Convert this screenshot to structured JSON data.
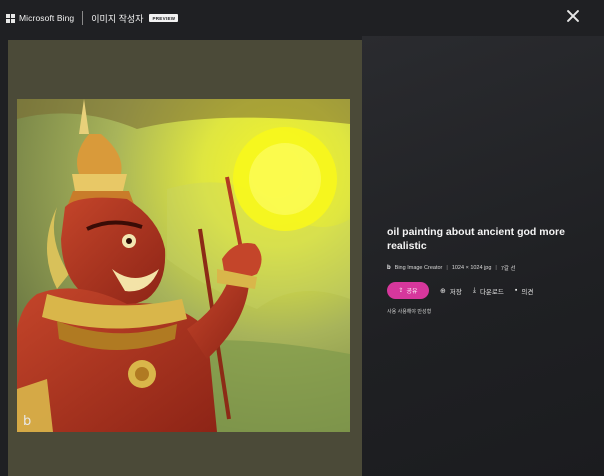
{
  "header": {
    "brand": "Microsoft Bing",
    "app_title": "이미지 작성자",
    "badge": "PREVIEW",
    "close_icon": "close-icon"
  },
  "colors": {
    "background": "#1f2023",
    "left_panel": "#4b4a38",
    "share_accent": "#d6379c"
  },
  "image": {
    "title": "oil painting about ancient god more realistic",
    "source": "Bing Image Creator",
    "dimensions": "1024 × 1024 jpg",
    "age": "7갈 선",
    "watermark": "b"
  },
  "actions": {
    "share": {
      "label": "공유",
      "icon": "share-icon"
    },
    "save": {
      "label": "저장",
      "icon": "save-icon"
    },
    "download": {
      "label": "다운로드",
      "icon": "download-icon"
    },
    "feedback": {
      "label": "의견",
      "icon": "feedback-icon"
    }
  },
  "owner_text": "사용 사용해야 만성형"
}
